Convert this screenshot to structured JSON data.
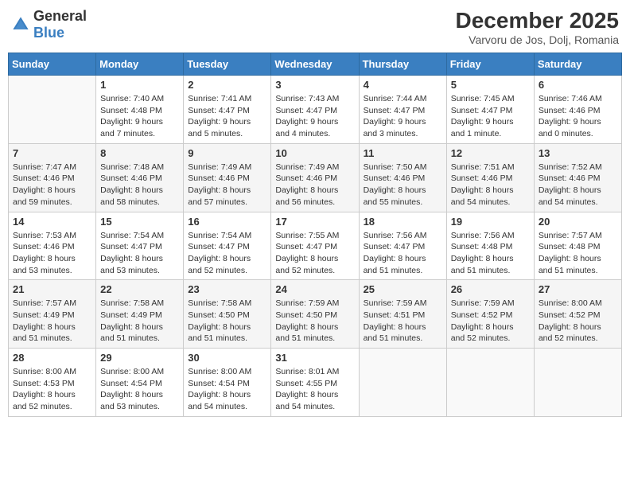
{
  "header": {
    "logo_general": "General",
    "logo_blue": "Blue",
    "month": "December 2025",
    "location": "Varvoru de Jos, Dolj, Romania"
  },
  "weekdays": [
    "Sunday",
    "Monday",
    "Tuesday",
    "Wednesday",
    "Thursday",
    "Friday",
    "Saturday"
  ],
  "rows": [
    [
      {
        "day": "",
        "content": ""
      },
      {
        "day": "1",
        "content": "Sunrise: 7:40 AM\nSunset: 4:48 PM\nDaylight: 9 hours\nand 7 minutes."
      },
      {
        "day": "2",
        "content": "Sunrise: 7:41 AM\nSunset: 4:47 PM\nDaylight: 9 hours\nand 5 minutes."
      },
      {
        "day": "3",
        "content": "Sunrise: 7:43 AM\nSunset: 4:47 PM\nDaylight: 9 hours\nand 4 minutes."
      },
      {
        "day": "4",
        "content": "Sunrise: 7:44 AM\nSunset: 4:47 PM\nDaylight: 9 hours\nand 3 minutes."
      },
      {
        "day": "5",
        "content": "Sunrise: 7:45 AM\nSunset: 4:47 PM\nDaylight: 9 hours\nand 1 minute."
      },
      {
        "day": "6",
        "content": "Sunrise: 7:46 AM\nSunset: 4:46 PM\nDaylight: 9 hours\nand 0 minutes."
      }
    ],
    [
      {
        "day": "7",
        "content": "Sunrise: 7:47 AM\nSunset: 4:46 PM\nDaylight: 8 hours\nand 59 minutes."
      },
      {
        "day": "8",
        "content": "Sunrise: 7:48 AM\nSunset: 4:46 PM\nDaylight: 8 hours\nand 58 minutes."
      },
      {
        "day": "9",
        "content": "Sunrise: 7:49 AM\nSunset: 4:46 PM\nDaylight: 8 hours\nand 57 minutes."
      },
      {
        "day": "10",
        "content": "Sunrise: 7:49 AM\nSunset: 4:46 PM\nDaylight: 8 hours\nand 56 minutes."
      },
      {
        "day": "11",
        "content": "Sunrise: 7:50 AM\nSunset: 4:46 PM\nDaylight: 8 hours\nand 55 minutes."
      },
      {
        "day": "12",
        "content": "Sunrise: 7:51 AM\nSunset: 4:46 PM\nDaylight: 8 hours\nand 54 minutes."
      },
      {
        "day": "13",
        "content": "Sunrise: 7:52 AM\nSunset: 4:46 PM\nDaylight: 8 hours\nand 54 minutes."
      }
    ],
    [
      {
        "day": "14",
        "content": "Sunrise: 7:53 AM\nSunset: 4:46 PM\nDaylight: 8 hours\nand 53 minutes."
      },
      {
        "day": "15",
        "content": "Sunrise: 7:54 AM\nSunset: 4:47 PM\nDaylight: 8 hours\nand 53 minutes."
      },
      {
        "day": "16",
        "content": "Sunrise: 7:54 AM\nSunset: 4:47 PM\nDaylight: 8 hours\nand 52 minutes."
      },
      {
        "day": "17",
        "content": "Sunrise: 7:55 AM\nSunset: 4:47 PM\nDaylight: 8 hours\nand 52 minutes."
      },
      {
        "day": "18",
        "content": "Sunrise: 7:56 AM\nSunset: 4:47 PM\nDaylight: 8 hours\nand 51 minutes."
      },
      {
        "day": "19",
        "content": "Sunrise: 7:56 AM\nSunset: 4:48 PM\nDaylight: 8 hours\nand 51 minutes."
      },
      {
        "day": "20",
        "content": "Sunrise: 7:57 AM\nSunset: 4:48 PM\nDaylight: 8 hours\nand 51 minutes."
      }
    ],
    [
      {
        "day": "21",
        "content": "Sunrise: 7:57 AM\nSunset: 4:49 PM\nDaylight: 8 hours\nand 51 minutes."
      },
      {
        "day": "22",
        "content": "Sunrise: 7:58 AM\nSunset: 4:49 PM\nDaylight: 8 hours\nand 51 minutes."
      },
      {
        "day": "23",
        "content": "Sunrise: 7:58 AM\nSunset: 4:50 PM\nDaylight: 8 hours\nand 51 minutes."
      },
      {
        "day": "24",
        "content": "Sunrise: 7:59 AM\nSunset: 4:50 PM\nDaylight: 8 hours\nand 51 minutes."
      },
      {
        "day": "25",
        "content": "Sunrise: 7:59 AM\nSunset: 4:51 PM\nDaylight: 8 hours\nand 51 minutes."
      },
      {
        "day": "26",
        "content": "Sunrise: 7:59 AM\nSunset: 4:52 PM\nDaylight: 8 hours\nand 52 minutes."
      },
      {
        "day": "27",
        "content": "Sunrise: 8:00 AM\nSunset: 4:52 PM\nDaylight: 8 hours\nand 52 minutes."
      }
    ],
    [
      {
        "day": "28",
        "content": "Sunrise: 8:00 AM\nSunset: 4:53 PM\nDaylight: 8 hours\nand 52 minutes."
      },
      {
        "day": "29",
        "content": "Sunrise: 8:00 AM\nSunset: 4:54 PM\nDaylight: 8 hours\nand 53 minutes."
      },
      {
        "day": "30",
        "content": "Sunrise: 8:00 AM\nSunset: 4:54 PM\nDaylight: 8 hours\nand 54 minutes."
      },
      {
        "day": "31",
        "content": "Sunrise: 8:01 AM\nSunset: 4:55 PM\nDaylight: 8 hours\nand 54 minutes."
      },
      {
        "day": "",
        "content": ""
      },
      {
        "day": "",
        "content": ""
      },
      {
        "day": "",
        "content": ""
      }
    ]
  ]
}
